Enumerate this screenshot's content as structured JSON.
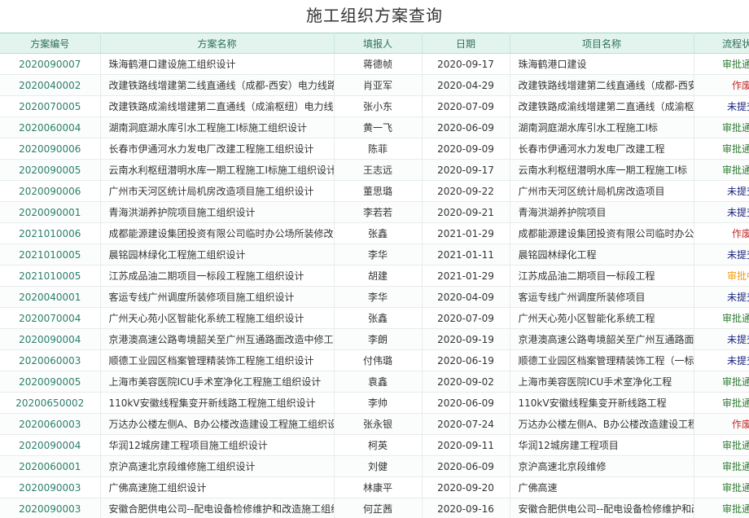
{
  "page": {
    "title": "施工组织方案查询"
  },
  "table": {
    "columns": [
      "方案编号",
      "方案名称",
      "填报人",
      "日期",
      "项目名称",
      "流程状态"
    ],
    "status_colors": {
      "审批通过": "#2e7d32",
      "作废": "#c62828",
      "未提交": "#1a237e",
      "审批中": "#f39c12"
    },
    "rows": [
      [
        "2020090007",
        "珠海鹤港口建设施工组织设计",
        "蒋德帧",
        "2020-09-17",
        "珠海鹤港口建设",
        "审批通过"
      ],
      [
        "2020040002",
        "改建铁路线增建第二线直通线（成都-西安）电力线路",
        "肖亚军",
        "2020-04-29",
        "改建铁路线增建第二线直通线（成都-西安",
        "作废"
      ],
      [
        "2020070005",
        "改建铁路成渝线增建第二直通线（成渝枢纽）电力线",
        "张小东",
        "2020-07-09",
        "改建铁路成渝线增建第二直通线（成渝枢",
        "未提交"
      ],
      [
        "2020060004",
        "湖南洞庭湖水库引水工程施工I标施工组织设计",
        "黄一飞",
        "2020-06-09",
        "湖南洞庭湖水库引水工程施工I标",
        "审批通过"
      ],
      [
        "2020090006",
        "长春市伊通河水力发电厂改建工程施工组织设计",
        "陈菲",
        "2020-09-09",
        "长春市伊通河水力发电厂改建工程",
        "审批通过"
      ],
      [
        "2020090005",
        "云南水利枢纽潜明水库一期工程施工I标施工组织设计",
        "王志远",
        "2020-09-17",
        "云南水利枢纽潜明水库一期工程施工I标",
        "审批通过"
      ],
      [
        "2020090006",
        "广州市天河区统计局机房改造项目施工组织设计",
        "董思璐",
        "2020-09-22",
        "广州市天河区统计局机房改造项目",
        "未提交"
      ],
      [
        "2020090001",
        "青海洪湖养护院项目施工组织设计",
        "李若若",
        "2020-09-21",
        "青海洪湖养护院项目",
        "未提交"
      ],
      [
        "2021010006",
        "成都能源建设集团投资有限公司临时办公场所装修改造",
        "张鑫",
        "2021-01-29",
        "成都能源建设集团投资有限公司临时办公",
        "作废"
      ],
      [
        "2021010005",
        "晨铭园林绿化工程施工组织设计",
        "李华",
        "2021-01-11",
        "晨铭园林绿化工程",
        "未提交"
      ],
      [
        "2021010005",
        "江苏成品油二期项目一标段工程施工组织设计",
        "胡建",
        "2021-01-29",
        "江苏成品油二期项目一标段工程",
        "审批中"
      ],
      [
        "2020040001",
        "客运专线广州调度所装修项目施工组织设计",
        "李华",
        "2020-04-09",
        "客运专线广州调度所装修项目",
        "未提交"
      ],
      [
        "2020070004",
        "广州天心苑小区智能化系统工程施工组织设计",
        "张鑫",
        "2020-07-09",
        "广州天心苑小区智能化系统工程",
        "审批通过"
      ],
      [
        "2020090004",
        "京港澳高速公路粤境韶关至广州互通路面改造中修工程",
        "李朗",
        "2020-09-19",
        "京港澳高速公路粤境韶关至广州互通路面",
        "未提交"
      ],
      [
        "2020060003",
        "顺德工业园区档案管理精装饰工程施工组织设计",
        "付伟璐",
        "2020-06-19",
        "顺德工业园区档案管理精装饰工程（一标",
        "未提交"
      ],
      [
        "2020090005",
        "上海市美容医院ICU手术室净化工程施工组织设计",
        "袁鑫",
        "2020-09-02",
        "上海市美容医院ICU手术室净化工程",
        "审批通过"
      ],
      [
        "20200650002",
        "110kV安徽线程集变开新线路工程施工组织设计",
        "李帅",
        "2020-06-09",
        "110kV安徽线程集变开新线路工程",
        "审批通过"
      ],
      [
        "2020060003",
        "万达办公楼左侧A、B办公楼改造建设工程施工组织设计",
        "张永银",
        "2020-07-24",
        "万达办公楼左侧A、B办公楼改造建设工程",
        "作废"
      ],
      [
        "2020090004",
        "华润12城房建工程项目施工组织设计",
        "柯英",
        "2020-09-11",
        "华润12城房建工程项目",
        "审批通过"
      ],
      [
        "2020060001",
        "京沪高速北京段维修施工组织设计",
        "刘健",
        "2020-06-09",
        "京沪高速北京段维修",
        "审批通过"
      ],
      [
        "2020090003",
        "广佛高速施工组织设计",
        "林康平",
        "2020-09-20",
        "广佛高速",
        "审批通过"
      ],
      [
        "2020090003",
        "安徽合肥供电公司--配电设备检修维护和改造施工组织",
        "何芷茜",
        "2020-09-16",
        "安徽合肥供电公司--配电设备检修维护和改",
        "审批通过"
      ]
    ]
  }
}
